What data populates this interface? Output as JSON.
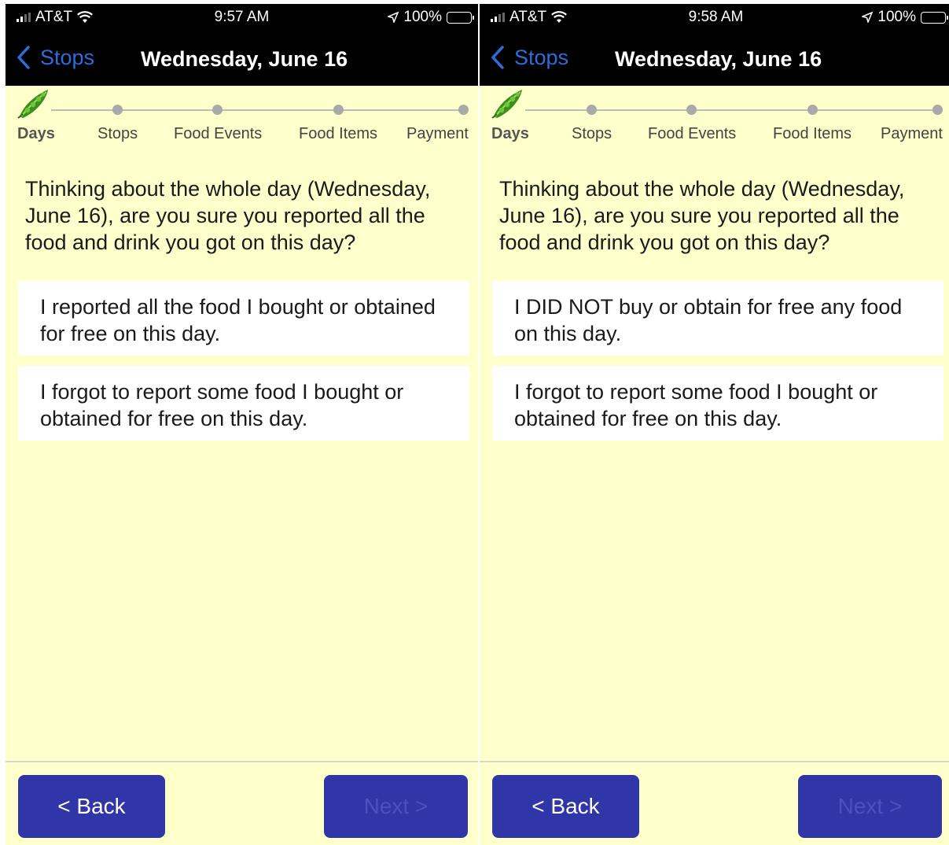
{
  "screens": [
    {
      "status": {
        "carrier": "AT&T",
        "time": "9:57 AM",
        "battery": "100%"
      },
      "nav": {
        "back_label": "Stops",
        "title": "Wednesday, June 16"
      },
      "steps": [
        "Days",
        "Stops",
        "Food Events",
        "Food Items",
        "Payment"
      ],
      "active_step": "Days",
      "question": "Thinking about the whole day (Wednesday, June 16), are you sure you reported all the food and drink you got on this day?",
      "options": [
        "I reported all the food I bought or obtained for free on this day.",
        "I forgot to report some food I bought or obtained for free on this day."
      ],
      "back_button": "< Back",
      "next_button": "Next >"
    },
    {
      "status": {
        "carrier": "AT&T",
        "time": "9:58 AM",
        "battery": "100%"
      },
      "nav": {
        "back_label": "Stops",
        "title": "Wednesday, June 16"
      },
      "steps": [
        "Days",
        "Stops",
        "Food Events",
        "Food Items",
        "Payment"
      ],
      "active_step": "Days",
      "question": "Thinking about the whole day (Wednesday, June 16), are you sure you reported all the food and drink you got on this day?",
      "options": [
        "I DID NOT buy or obtain for free any food on this day.",
        "I forgot to report some food I bought or obtained for free on this day."
      ],
      "back_button": "< Back",
      "next_button": "Next >"
    }
  ],
  "colors": {
    "background": "#ffffcc",
    "header": "#000000",
    "link": "#2f6cdb",
    "button": "#3035a8",
    "button_disabled_text": "#4c51c0",
    "option_bg": "#ffffff"
  },
  "icons": {
    "signal": "signal-bars-icon",
    "wifi": "wifi-icon",
    "location": "location-arrow-icon",
    "battery": "battery-icon",
    "back": "chevron-left-icon",
    "progress": "pea-pod-icon"
  }
}
